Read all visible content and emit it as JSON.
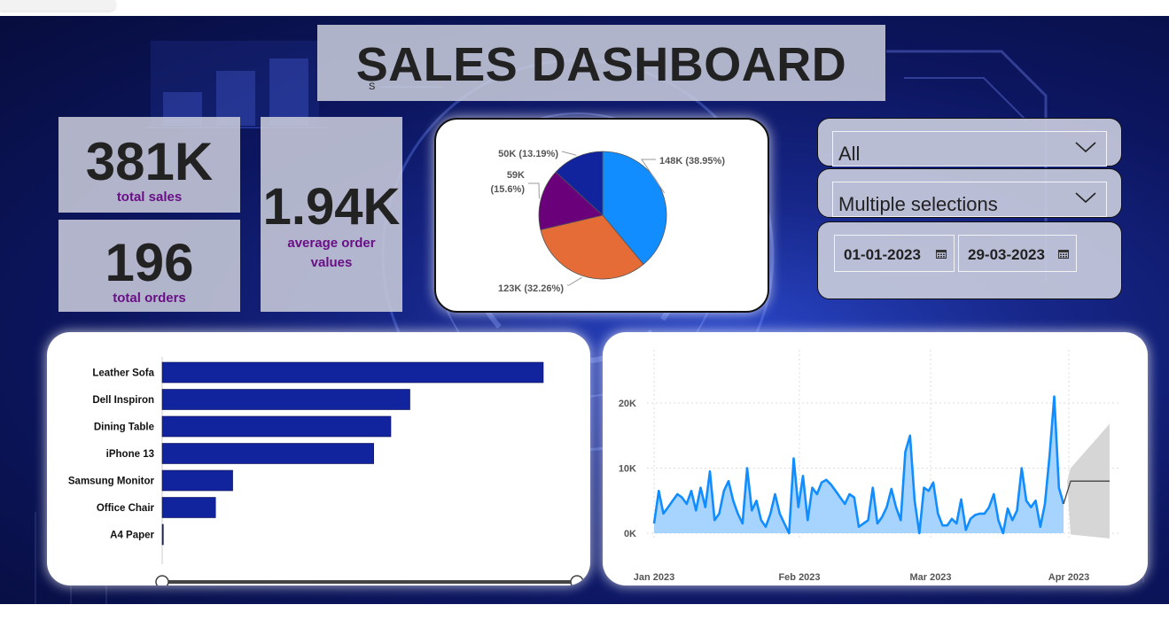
{
  "header": {
    "small_text": "S",
    "title": "SALES DASHBOARD"
  },
  "kpis": {
    "total_sales": {
      "value": "381K",
      "label": "total sales"
    },
    "total_orders": {
      "value": "196",
      "label": "total orders"
    },
    "avg_order": {
      "value": "1.94K",
      "label_line1": "average order",
      "label_line2": "values"
    }
  },
  "slicers": {
    "category": {
      "selected": "All"
    },
    "products": {
      "selected": "Multiple selections"
    },
    "date_range": {
      "start": "01-01-2023",
      "end": "29-03-2023"
    }
  },
  "colors": {
    "pie": [
      "#118dff",
      "#e66c37",
      "#6b007b",
      "#12239e"
    ],
    "bar": "#12239e",
    "line": "#118dff",
    "area": "#a7d3ff",
    "forecast": "#d6d6d6"
  },
  "icons": {
    "calendar": "calendar-icon",
    "chevron": "chevron-down-icon"
  },
  "chart_data": [
    {
      "type": "pie",
      "values": [
        148,
        123,
        59,
        50
      ],
      "labels": [
        "148K (38.95%)",
        "123K (32.26%)",
        "59K (15.6%)",
        "50K (13.19%)"
      ]
    },
    {
      "type": "bar",
      "orientation": "horizontal",
      "categories": [
        "Leather Sofa",
        "Dell Inspiron",
        "Dining Table",
        "iPhone 13",
        "Samsung Monitor",
        "Office Chair",
        "A4 Paper"
      ],
      "values": [
        100,
        65,
        60,
        55.5,
        18.5,
        14,
        0.3
      ]
    },
    {
      "type": "area",
      "x_ticks": [
        "Jan 2023",
        "Feb 2023",
        "Mar 2023",
        "Apr 2023"
      ],
      "y_ticks": [
        "0K",
        "10K",
        "20K"
      ],
      "ylim": [
        0,
        20000
      ],
      "values": [
        1500,
        6500,
        3000,
        4000,
        5000,
        6000,
        5500,
        4500,
        6500,
        3500,
        7000,
        4000,
        9500,
        2000,
        3000,
        6500,
        8000,
        5000,
        3000,
        1500,
        10000,
        3500,
        5000,
        2000,
        1000,
        3000,
        6000,
        3000,
        1500,
        0,
        11500,
        4000,
        8800,
        2000,
        7000,
        6000,
        7800,
        8200,
        7500,
        6500,
        5500,
        4500,
        6000,
        5500,
        1000,
        1500,
        2000,
        7000,
        1500,
        2500,
        4000,
        6800,
        4000,
        2000,
        12500,
        15000,
        5000,
        0,
        7000,
        6500,
        7800,
        3000,
        1200,
        1200,
        2200,
        1500,
        5200,
        500,
        2200,
        2800,
        3000,
        3000,
        4000,
        6000,
        2000,
        0,
        3800,
        2000,
        3500,
        10000,
        5000,
        4000,
        5000,
        1000,
        4500,
        12000,
        21000,
        7000,
        4500
      ],
      "forecast": {
        "value": 8000,
        "upper": 16800,
        "lower": -800
      }
    }
  ]
}
